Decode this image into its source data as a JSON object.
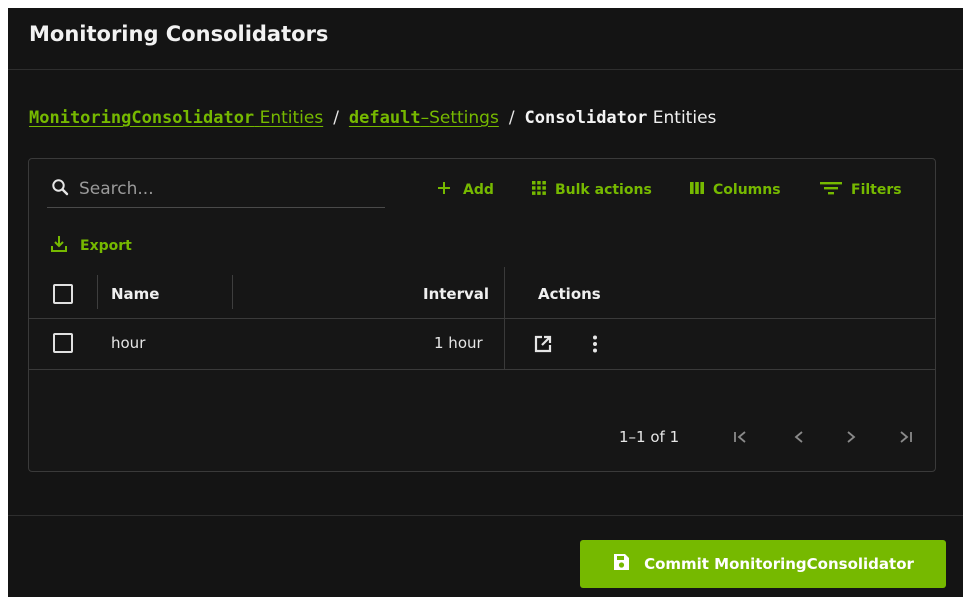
{
  "window": {
    "title": "Monitoring Consolidators"
  },
  "breadcrumb": {
    "items": [
      {
        "code": "MonitoringConsolidator",
        "text": "Entities"
      },
      {
        "code": "default",
        "dash": "–",
        "text": "Settings"
      },
      {
        "code": "Consolidator",
        "text": "Entities"
      }
    ],
    "separator": "/"
  },
  "toolbar": {
    "search_placeholder": "Search...",
    "add_label": "Add",
    "bulk_actions_label": "Bulk actions",
    "columns_label": "Columns",
    "filters_label": "Filters",
    "export_label": "Export"
  },
  "table": {
    "columns": [
      "Name",
      "Interval",
      "Actions"
    ],
    "rows": [
      {
        "name": "hour",
        "interval": "1 hour"
      }
    ]
  },
  "pagination": {
    "range_text": "1–1 of 1"
  },
  "footer": {
    "commit_label": "Commit MonitoringConsolidator"
  },
  "colors": {
    "accent": "#76b900",
    "background": "#141414",
    "border": "#3a3a3a"
  },
  "icons": [
    "search-icon",
    "plus-icon",
    "grid-icon",
    "columns-icon",
    "filter-icon",
    "download-icon",
    "open-external-icon",
    "more-vert-icon",
    "first-page-icon",
    "prev-page-icon",
    "next-page-icon",
    "last-page-icon",
    "save-icon"
  ]
}
